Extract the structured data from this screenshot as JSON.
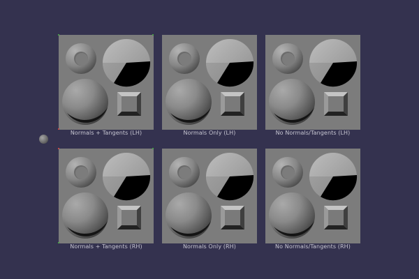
{
  "scene": {
    "background": "#34324f",
    "panel_color": "#7c7c7c"
  },
  "panels": [
    {
      "caption": "Normals + Tangents (LH)"
    },
    {
      "caption": "Normals Only (LH)"
    },
    {
      "caption": "No Normals/Tangents (LH)"
    },
    {
      "caption": "Normals + Tangents (RH)"
    },
    {
      "caption": "Normals Only (RH)"
    },
    {
      "caption": "No Normals/Tangents (RH)"
    }
  ],
  "icons": {
    "light": "light-sphere-icon"
  }
}
